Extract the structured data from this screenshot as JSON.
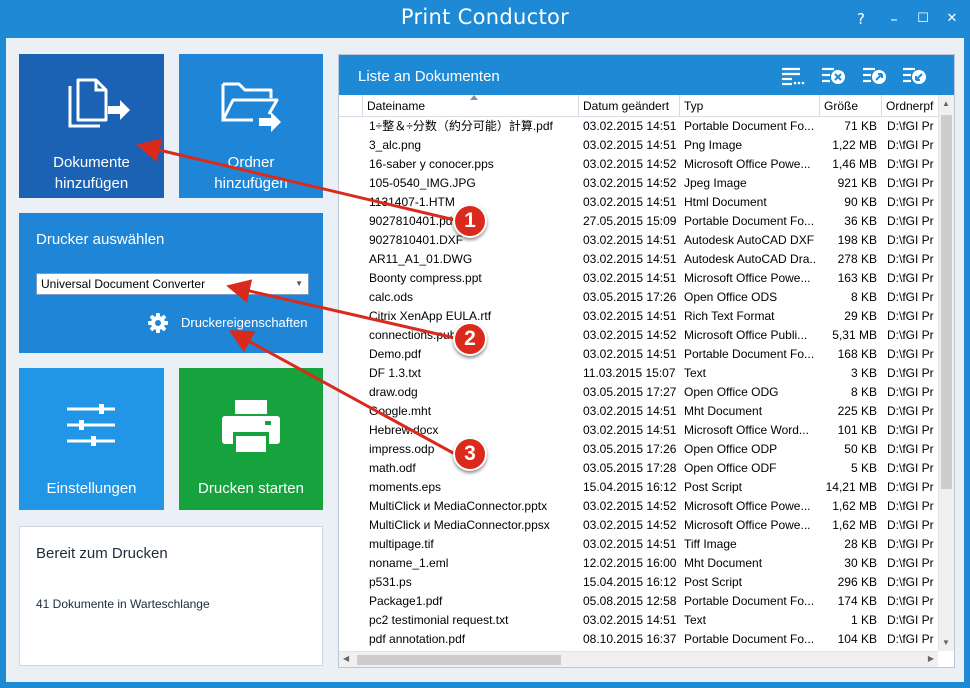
{
  "window": {
    "title": "Print Conductor",
    "help": "?",
    "minimize": "–",
    "maximize": "☐",
    "close": "✕"
  },
  "tiles": {
    "add_documents": {
      "line1": "Dokumente",
      "line2": "hinzufügen"
    },
    "add_folder": {
      "line1": "Ordner",
      "line2": "hinzufügen"
    },
    "settings": "Einstellungen",
    "start_printing": "Drucken starten"
  },
  "printer": {
    "heading": "Drucker auswählen",
    "selected": "Universal Document Converter",
    "properties_label": "Druckereigenschaften"
  },
  "status": {
    "title": "Bereit zum Drucken",
    "queue": "41 Dokumente in Warteschlange"
  },
  "document_list": {
    "title": "Liste an Dokumenten",
    "columns": [
      "Dateiname",
      "Datum geändert",
      "Typ",
      "Größe",
      "Ordnerpf"
    ],
    "rows": [
      [
        "1÷整＆÷分数（約分可能）計算.pdf",
        "03.02.2015 14:51",
        "Portable Document Fo...",
        "71 KB",
        "D:\\fGI Pr"
      ],
      [
        "3_alc.png",
        "03.02.2015 14:51",
        "Png Image",
        "1,22 MB",
        "D:\\fGI Pr"
      ],
      [
        "16-saber y conocer.pps",
        "03.02.2015 14:52",
        "Microsoft Office Powe...",
        "1,46 MB",
        "D:\\fGI Pr"
      ],
      [
        "105-0540_IMG.JPG",
        "03.02.2015 14:52",
        "Jpeg Image",
        "921 KB",
        "D:\\fGI Pr"
      ],
      [
        "1131407-1.HTM",
        "03.02.2015 14:51",
        "Html Document",
        "90 KB",
        "D:\\fGI Pr"
      ],
      [
        "9027810401.pdf",
        "27.05.2015 15:09",
        "Portable Document Fo...",
        "36 KB",
        "D:\\fGI Pr"
      ],
      [
        "9027810401.DXF",
        "03.02.2015 14:51",
        "Autodesk AutoCAD DXF",
        "198 KB",
        "D:\\fGI Pr"
      ],
      [
        "AR11_A1_01.DWG",
        "03.02.2015 14:51",
        "Autodesk AutoCAD Dra...",
        "278 KB",
        "D:\\fGI Pr"
      ],
      [
        "Boonty compress.ppt",
        "03.02.2015 14:51",
        "Microsoft Office Powe...",
        "163 KB",
        "D:\\fGI Pr"
      ],
      [
        "calc.ods",
        "03.05.2015 17:26",
        "Open Office ODS",
        "8 KB",
        "D:\\fGI Pr"
      ],
      [
        "Citrix XenApp EULA.rtf",
        "03.02.2015 14:51",
        "Rich Text Format",
        "29 KB",
        "D:\\fGI Pr"
      ],
      [
        "connections.pub",
        "03.02.2015 14:52",
        "Microsoft Office Publi...",
        "5,31 MB",
        "D:\\fGI Pr"
      ],
      [
        "Demo.pdf",
        "03.02.2015 14:51",
        "Portable Document Fo...",
        "168 KB",
        "D:\\fGI Pr"
      ],
      [
        "DF 1.3.txt",
        "11.03.2015 15:07",
        "Text",
        "3 KB",
        "D:\\fGI Pr"
      ],
      [
        "draw.odg",
        "03.05.2015 17:27",
        "Open Office ODG",
        "8 KB",
        "D:\\fGI Pr"
      ],
      [
        "Google.mht",
        "03.02.2015 14:51",
        "Mht Document",
        "225 KB",
        "D:\\fGI Pr"
      ],
      [
        "Hebrew.docx",
        "03.02.2015 14:51",
        "Microsoft Office Word...",
        "101 KB",
        "D:\\fGI Pr"
      ],
      [
        "impress.odp",
        "03.05.2015 17:26",
        "Open Office ODP",
        "50 KB",
        "D:\\fGI Pr"
      ],
      [
        "math.odf",
        "03.05.2015 17:28",
        "Open Office ODF",
        "5 KB",
        "D:\\fGI Pr"
      ],
      [
        "moments.eps",
        "15.04.2015 16:12",
        "Post Script",
        "14,21 MB",
        "D:\\fGI Pr"
      ],
      [
        "MultiClick и MediaConnector.pptx",
        "03.02.2015 14:52",
        "Microsoft Office Powe...",
        "1,62 MB",
        "D:\\fGI Pr"
      ],
      [
        "MultiClick и MediaConnector.ppsx",
        "03.02.2015 14:52",
        "Microsoft Office Powe...",
        "1,62 MB",
        "D:\\fGI Pr"
      ],
      [
        "multipage.tif",
        "03.02.2015 14:51",
        "Tiff Image",
        "28 KB",
        "D:\\fGI Pr"
      ],
      [
        "noname_1.eml",
        "12.02.2015 16:00",
        "Mht Document",
        "30 KB",
        "D:\\fGI Pr"
      ],
      [
        "p531.ps",
        "15.04.2015 16:12",
        "Post Script",
        "296 KB",
        "D:\\fGI Pr"
      ],
      [
        "Package1.pdf",
        "05.08.2015 12:58",
        "Portable Document Fo...",
        "174 KB",
        "D:\\fGI Pr"
      ],
      [
        "pc2 testimonial request.txt",
        "03.02.2015 14:51",
        "Text",
        "1 KB",
        "D:\\fGI Pr"
      ],
      [
        "pdf annotation.pdf",
        "08.10.2015 16:37",
        "Portable Document Fo...",
        "104 KB",
        "D:\\fGI Pr"
      ]
    ]
  },
  "callouts": [
    "1",
    "2",
    "3"
  ],
  "colors": {
    "accent": "#1e8ad6",
    "tile_dark": "#1b62b4",
    "start_green": "#16a23c",
    "callout_red": "#d92a1b"
  }
}
